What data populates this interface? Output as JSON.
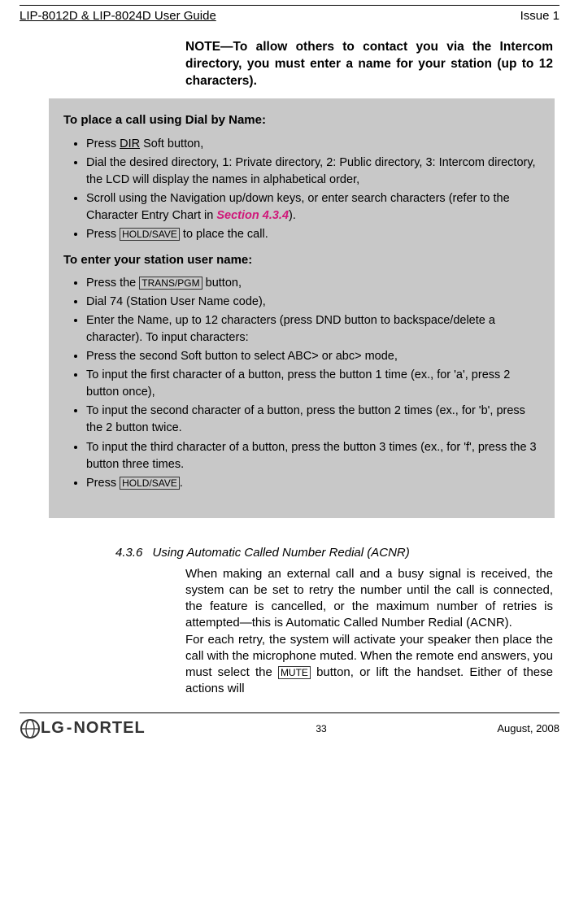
{
  "header": {
    "guide_title": "LIP-8012D & LIP-8024D User Guide",
    "issue": "Issue 1"
  },
  "note": {
    "text": "NOTE—To allow others to contact you via the Intercom directory, you must enter a name for your station (up to 12 characters)."
  },
  "box": {
    "heading1": "To place a call using Dial by Name:",
    "items1": {
      "press_label": "Press ",
      "dir_label": "DIR",
      "press_after": " Soft button,",
      "dial_desired": "Dial the desired directory, 1: Private directory, 2: Public directory, 3: Intercom directory, the LCD will display the names in alphabetical order,",
      "scroll_pre": "Scroll using the Navigation up/down keys, or enter search characters (refer to the Character Entry Chart in ",
      "section_ref": "Section 4.3.4",
      "scroll_post": ").",
      "press2_label": "Press ",
      "holdsave1": "HOLD/SAVE",
      "press2_after": " to place the call."
    },
    "heading2": "To enter your station user name:",
    "items2": {
      "press_the": "Press the ",
      "transpgm": "TRANS/PGM",
      "button_after": " button,",
      "dial74": "Dial 74 (Station User Name code),",
      "enter_name": "Enter the Name, up to 12 characters (press DND button to backspace/delete a character). To input characters:",
      "press_second": "Press the second Soft button to select ABC> or abc> mode,",
      "input_first": "To input the first character of a button, press the button 1 time (ex., for 'a', press 2 button once),",
      "input_second": "To input the second character of a button, press the button 2 times (ex., for 'b', press the 2 button twice.",
      "input_third": "To input the third character of a button, press the button 3 times (ex., for 'f', press the 3 button three times.",
      "press_final": "Press ",
      "holdsave2": "HOLD/SAVE",
      "press_final_after": "."
    }
  },
  "section": {
    "number": "4.3.6",
    "title": "Using Automatic Called Number Redial (ACNR)",
    "para1": "When making an external call and a busy signal is received, the system can be set to retry the number until the call is connected, the feature is cancelled, or the maximum number of retries is attempted—this is Automatic Called Number Redial (ACNR).",
    "para2_pre": "For each retry, the system will activate your speaker then place the call with the microphone muted.  When the remote end answers, you must select the ",
    "mute_key": "MUTE",
    "para2_post": " button, or lift the handset.  Either of these actions will"
  },
  "footer": {
    "logo_lg": "LG",
    "logo_nortel": "NORTEL",
    "page_num": "33",
    "date": "August, 2008"
  }
}
